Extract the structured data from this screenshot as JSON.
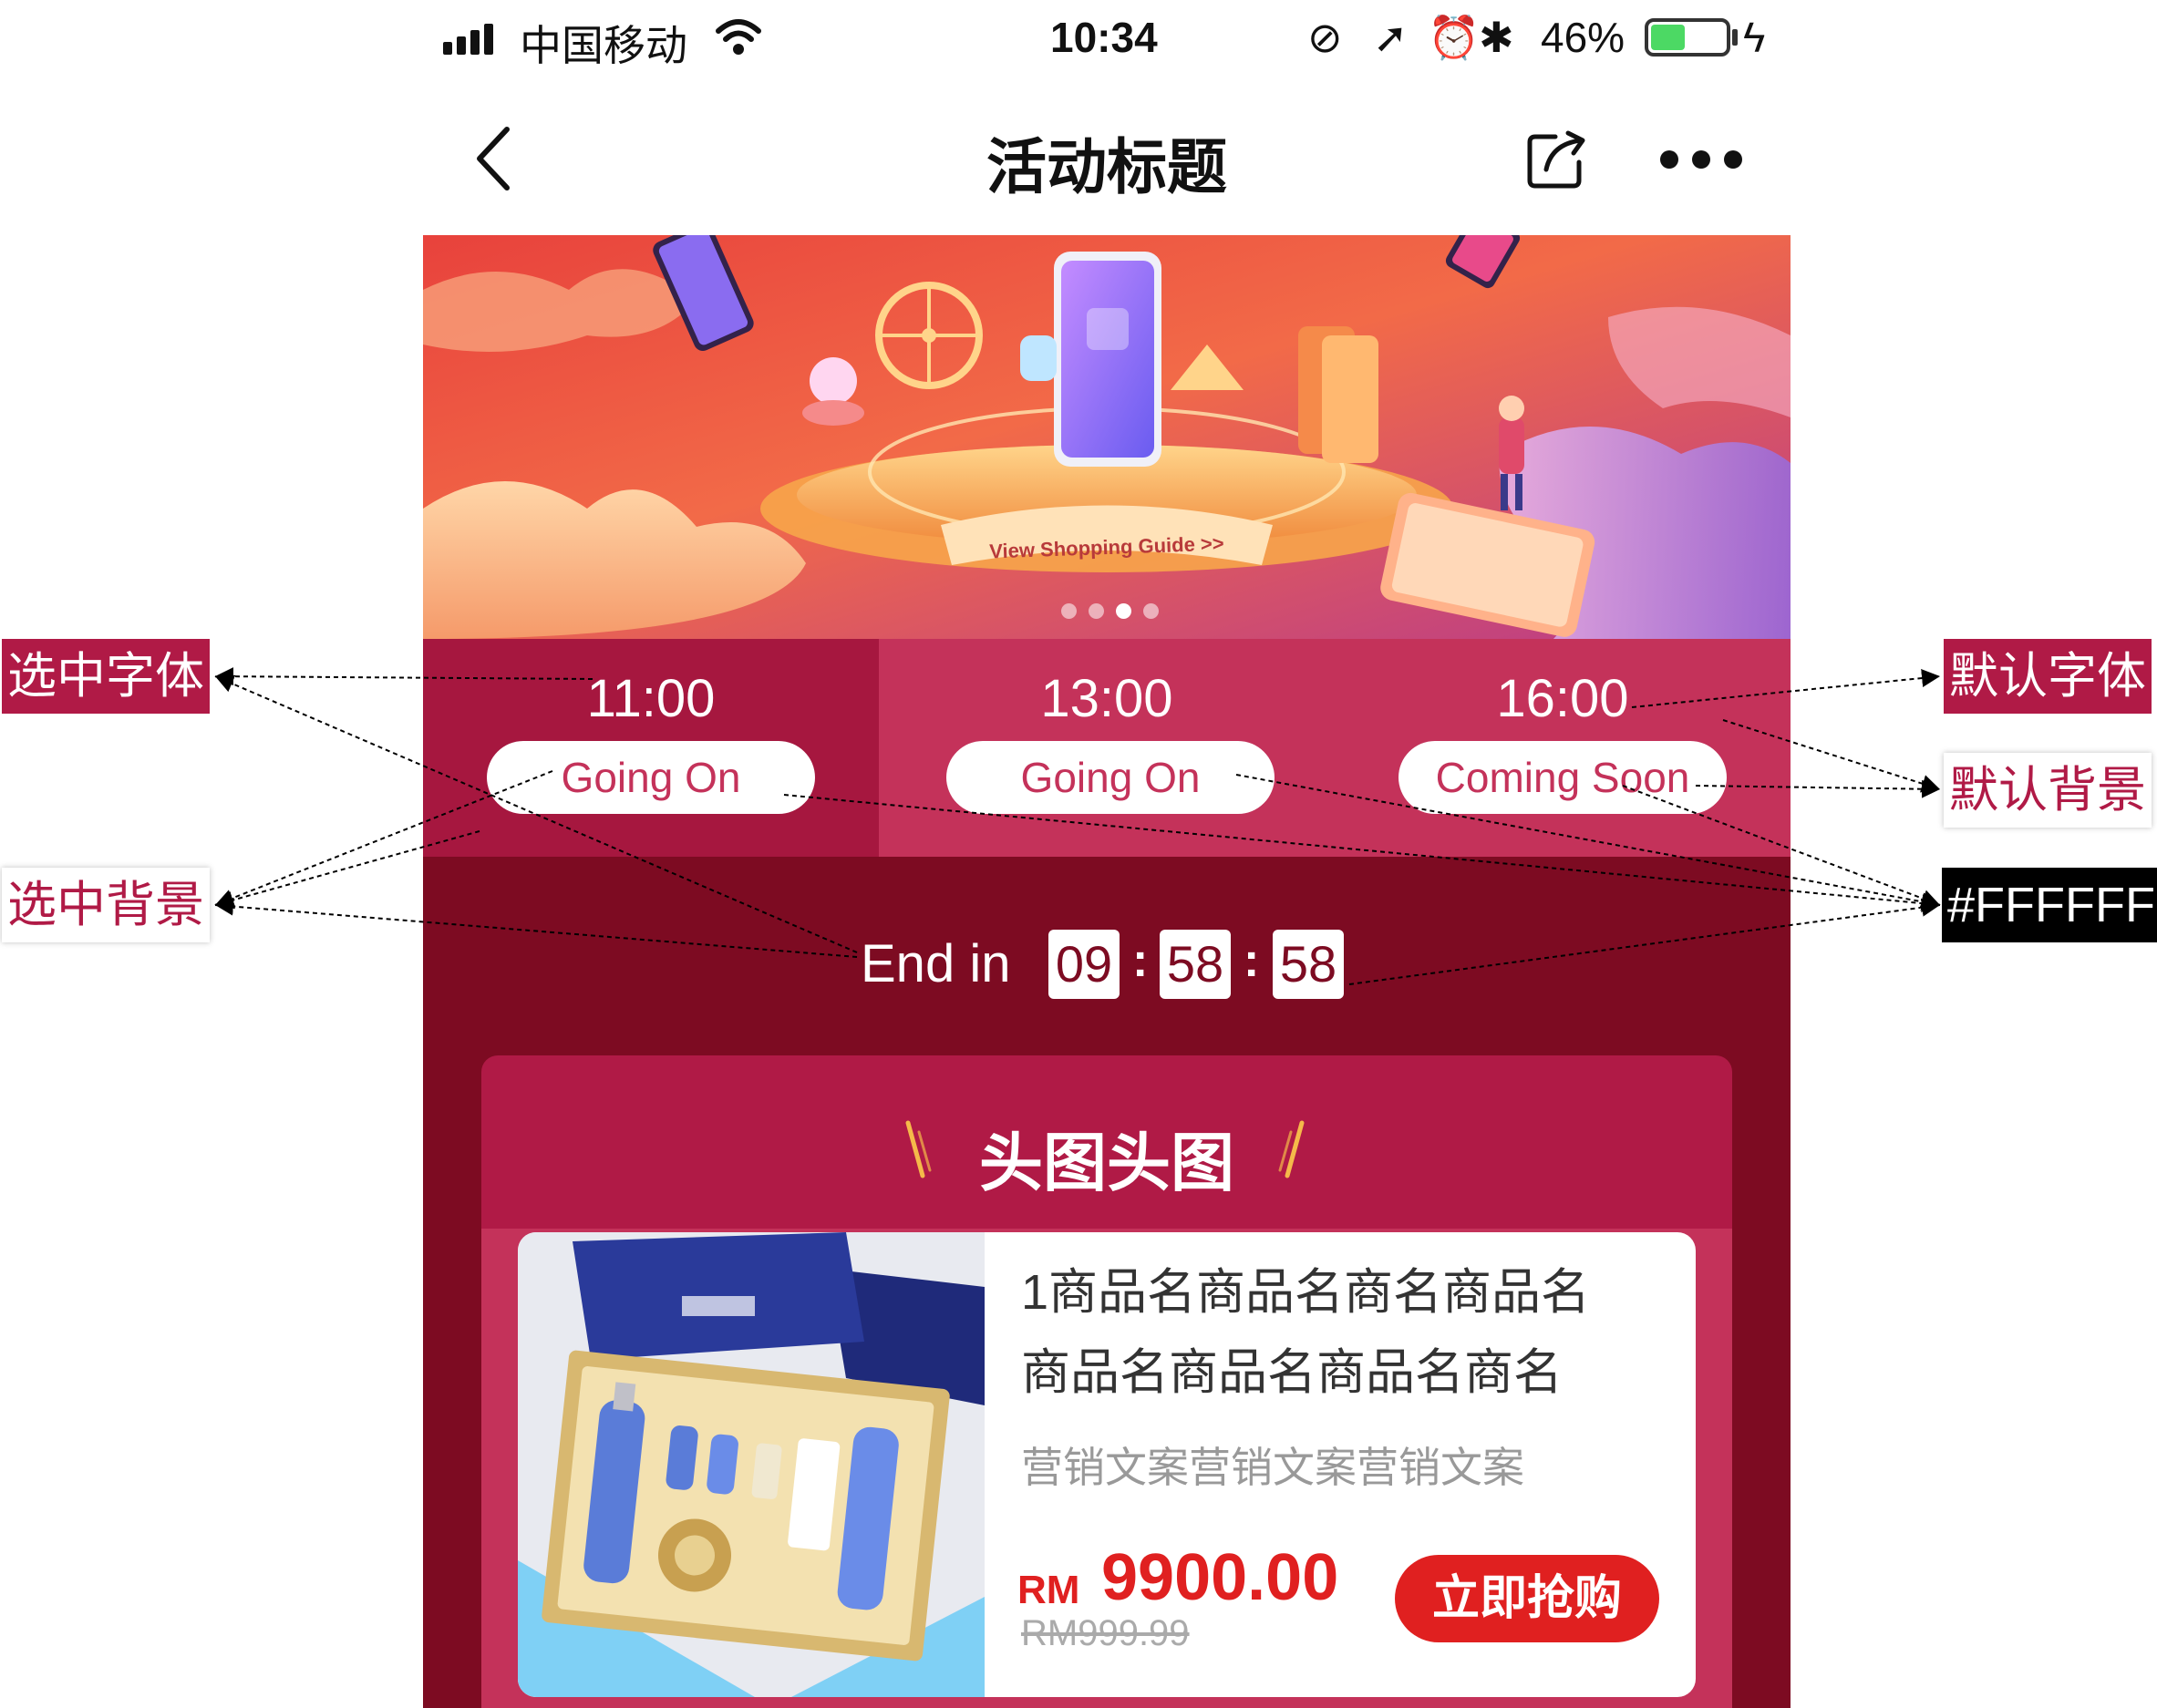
{
  "status_bar": {
    "carrier": "中国移动",
    "time": "10:34",
    "battery": "46%",
    "battery_level": 0.46
  },
  "nav": {
    "title": "活动标题"
  },
  "banner": {
    "button_label": "View Shopping Guide  >>",
    "dots_count": 4,
    "active_dot": 3
  },
  "tabs": [
    {
      "time": "11:00",
      "status": "Going On",
      "selected": true
    },
    {
      "time": "13:00",
      "status": "Going On",
      "selected": false
    },
    {
      "time": "16:00",
      "status": "Coming Soon",
      "selected": false
    }
  ],
  "countdown": {
    "label": "End in",
    "hours": "09",
    "minutes": "58",
    "seconds": "58",
    "separator": ":"
  },
  "section": {
    "title": "头图头图"
  },
  "product": {
    "name_line1": "1商品名商品名商名商品名",
    "name_line2": "商品名商品名商品名商名",
    "marketing": "营销文案营销文案营销文案",
    "currency": "RM",
    "price": "9900.00",
    "original_price": "RM999.99",
    "buy_label": "立即抢购"
  },
  "annotations": {
    "selected_font": "选中字体",
    "selected_bg": "选中背景",
    "default_font": "默认字体",
    "default_bg": "默认背景",
    "white_hex": "#FFFFFF"
  },
  "colors": {
    "selected_bg": "#a6173f",
    "default_bg": "#c4325a",
    "countdown_bg": "#7d0b22",
    "panel_bg": "#b01a46",
    "accent_red": "#e02020",
    "white": "#FFFFFF"
  }
}
